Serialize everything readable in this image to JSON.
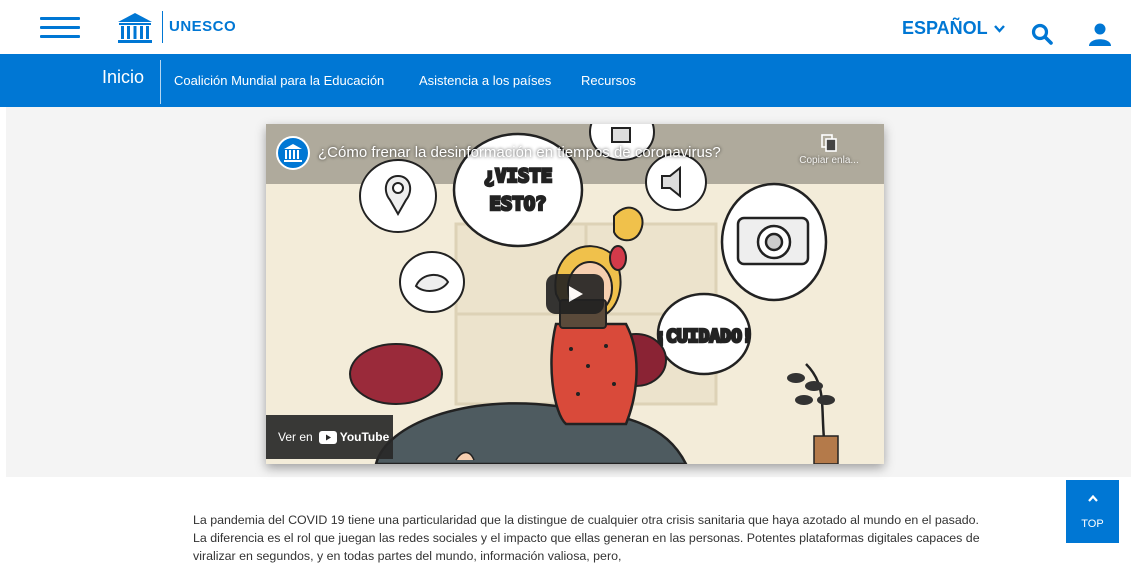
{
  "header": {
    "brand": "UNESCO",
    "language": "ESPAÑOL",
    "icons": {
      "menu": "hamburger-icon",
      "search": "search-icon",
      "user": "user-icon",
      "logo": "unesco-temple-logo"
    }
  },
  "nav": {
    "home": "Inicio",
    "links": [
      "Coalición Mundial para la Educación",
      "Asistencia a los países",
      "Recursos"
    ]
  },
  "video": {
    "title": "¿Cómo frenar la desinformación en tiempos de coronavirus?",
    "copy_link": "Copiar enla...",
    "watch_on": "Ver en",
    "youtube": "YouTube",
    "bubble_1": "¿VISTE",
    "bubble_2": "ESTO?",
    "bubble_3": "¡CUIDADO!"
  },
  "article": {
    "paragraph": "La pandemia del COVID 19 tiene una particularidad que la distingue de cualquier otra crisis sanitaria que haya azotado al mundo en el pasado. La diferencia es el rol que juegan las redes sociales y el impacto que ellas generan en las personas. Potentes plataformas digitales capaces de viralizar en segundos, y en todas partes del mundo, información valiosa, pero,"
  },
  "scroll_top": {
    "label": "TOP"
  },
  "colors": {
    "brand_blue": "#0077d4",
    "band_gray": "#f4f4f4"
  }
}
